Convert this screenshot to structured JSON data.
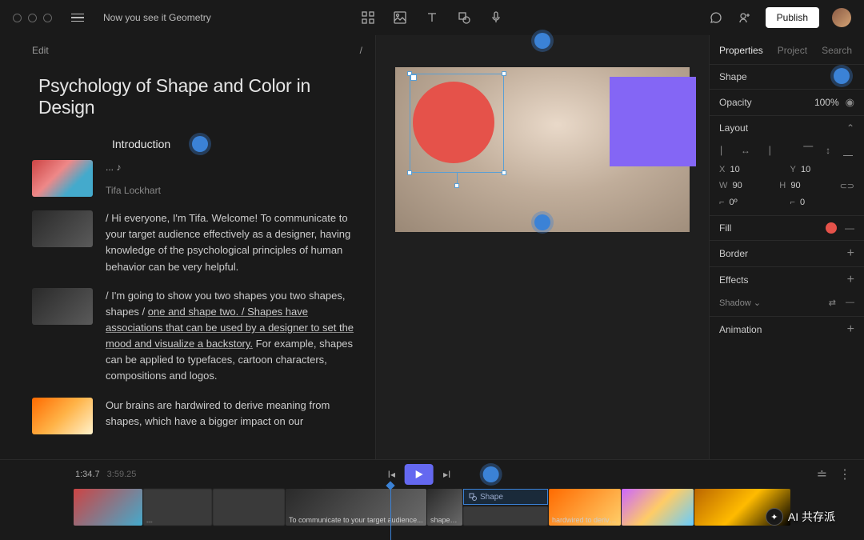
{
  "topbar": {
    "doc_title": "Now you see it Geometry",
    "publish_label": "Publish"
  },
  "editor": {
    "head_left": "Edit",
    "head_right": "/",
    "title": "Psychology of Shape and Color in Design",
    "section": "Introduction",
    "ellipsis": "... ♪",
    "speaker": "Tifa Lockhart",
    "p1": "/ Hi everyone, I'm Tifa. Welcome! To communicate to your target audience effectively as a designer, having knowledge of the psychological principles of human behavior can be very helpful.",
    "p2_a": "/ I'm going to show you two shapes you two shapes, shapes / ",
    "p2_u": "one and shape two. / Shapes have associations that can be used by a designer to set the mood and visualize a backstory.",
    "p2_b": " For example, shapes can be applied to typefaces, cartoon characters, compositions and logos.",
    "p3": "Our brains are hardwired to derive meaning from shapes, which have a bigger impact on our"
  },
  "panel": {
    "tab_properties": "Properties",
    "tab_project": "Project",
    "tab_search": "Search",
    "shape_label": "Shape",
    "opacity_label": "Opacity",
    "opacity_value": "100%",
    "layout_label": "Layout",
    "x_label": "X",
    "x_value": "10",
    "y_label": "Y",
    "y_value": "10",
    "w_label": "W",
    "w_value": "90",
    "h_label": "H",
    "h_value": "90",
    "rot_label": "⌐",
    "rot_value": "0º",
    "corner_label": "⌐",
    "corner_value": "0",
    "fill_label": "Fill",
    "border_label": "Border",
    "effects_label": "Effects",
    "shadow_label": "Shadow",
    "animation_label": "Animation"
  },
  "transport": {
    "current": "1:34.7",
    "duration": "3:59.25"
  },
  "timeline": {
    "shape_clip": "Shape",
    "clip2": "...",
    "clip3": "To communicate to your target audience...",
    "clip4": "shapes one and shape two....",
    "clip6": "hardwired to derive meaning from shapes, which have a bigger impact on our su"
  },
  "watermark": "AI 共存派"
}
